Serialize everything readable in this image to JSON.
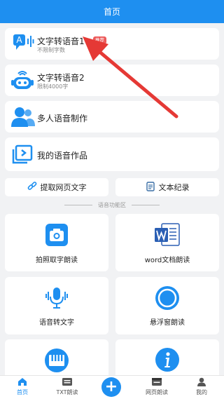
{
  "header": {
    "title": "首页"
  },
  "features": [
    {
      "title": "文字转语音1",
      "subtitle": "不限制字数",
      "badge": "推荐",
      "icon": "text-to-speech-icon"
    },
    {
      "title": "文字转语音2",
      "subtitle": "限制4000字",
      "icon": "robot-icon"
    },
    {
      "title": "多人语音制作",
      "icon": "multi-user-icon"
    },
    {
      "title": "我的语音作品",
      "icon": "folder-icon"
    }
  ],
  "half_buttons": [
    {
      "label": "提取网页文字",
      "icon": "link-icon"
    },
    {
      "label": "文本纪录",
      "icon": "document-list-icon"
    }
  ],
  "section": {
    "label": "语音功能区"
  },
  "tiles": [
    {
      "label": "拍照取字朗读",
      "icon": "camera-icon"
    },
    {
      "label": "word文档朗读",
      "icon": "word-icon"
    },
    {
      "label": "语音转文字",
      "icon": "microphone-icon"
    },
    {
      "label": "悬浮窗朗读",
      "icon": "floating-window-icon"
    },
    {
      "label": "",
      "icon": "piano-icon"
    },
    {
      "label": "",
      "icon": "info-icon"
    }
  ],
  "tabbar": {
    "items": [
      {
        "label": "首页",
        "icon": "home-icon",
        "active": true
      },
      {
        "label": "TXT朗读",
        "icon": "txt-icon"
      },
      {
        "label": "",
        "icon": "plus-icon"
      },
      {
        "label": "网页朗读",
        "icon": "webpage-icon"
      },
      {
        "label": "我的",
        "icon": "profile-icon"
      }
    ]
  },
  "colors": {
    "primary": "#1e8ff0",
    "badge": "#ec5a5a",
    "arrow": "#e53935",
    "background": "#f1f2f4"
  }
}
